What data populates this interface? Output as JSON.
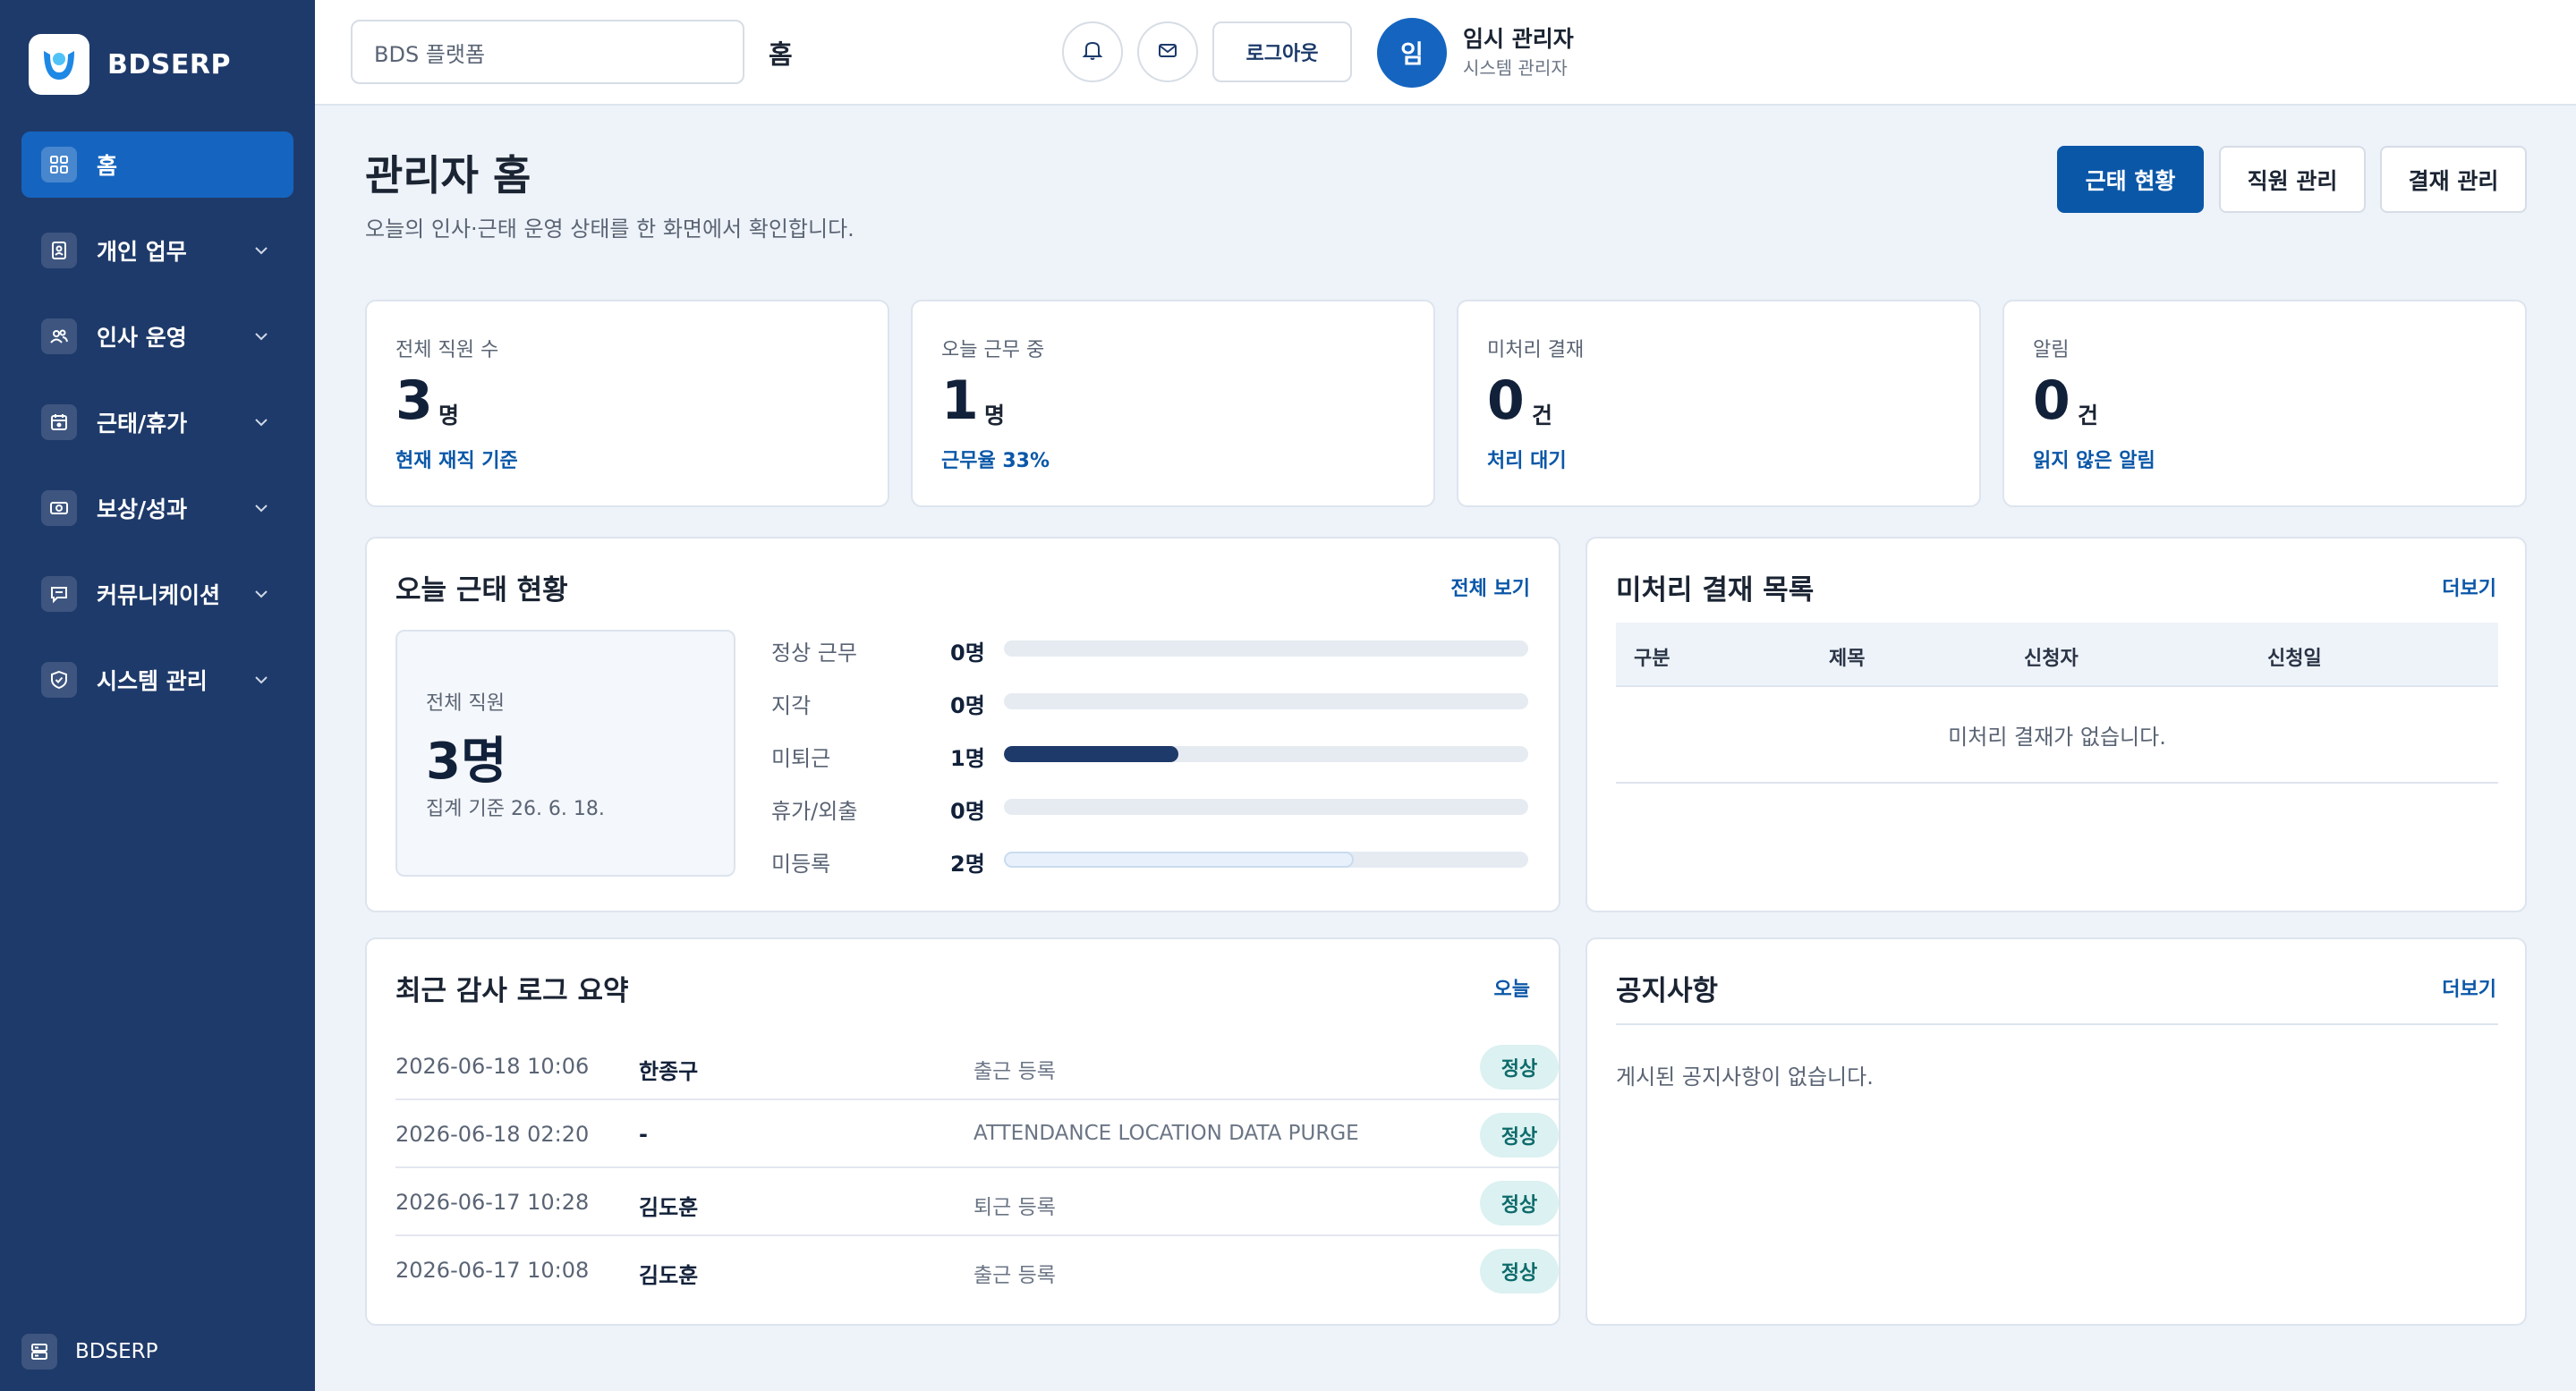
{
  "app": {
    "name": "BDSERP",
    "footer_label": "BDSERP"
  },
  "sidebar": {
    "items": [
      {
        "label": "홈",
        "icon": "grid-icon",
        "active": true
      },
      {
        "label": "개인 업무",
        "icon": "id-card-icon"
      },
      {
        "label": "인사 운영",
        "icon": "users-icon"
      },
      {
        "label": "근태/휴가",
        "icon": "calendar-icon"
      },
      {
        "label": "보상/성과",
        "icon": "money-icon"
      },
      {
        "label": "커뮤니케이션",
        "icon": "chat-icon"
      },
      {
        "label": "시스템 관리",
        "icon": "shield-icon"
      }
    ]
  },
  "header": {
    "platform": "BDS 플랫폼",
    "breadcrumb": "홈",
    "logout_label": "로그아웃",
    "user": {
      "initial": "임",
      "name": "임시 관리자",
      "role": "시스템 관리자"
    }
  },
  "page": {
    "title": "관리자 홈",
    "subtitle": "오늘의 인사·근태 운영 상태를 한 화면에서 확인합니다.",
    "actions": [
      "근태 현황",
      "직원 관리",
      "결재 관리"
    ]
  },
  "stats": [
    {
      "label": "전체 직원 수",
      "value": "3",
      "unit": "명",
      "foot": "현재 재직 기준"
    },
    {
      "label": "오늘 근무 중",
      "value": "1",
      "unit": "명",
      "foot": "근무율 33%"
    },
    {
      "label": "미처리 결재",
      "value": "0",
      "unit": "건",
      "foot": "처리 대기"
    },
    {
      "label": "알림",
      "value": "0",
      "unit": "건",
      "foot": "읽지 않은 알림"
    }
  ],
  "attendance": {
    "title": "오늘 근태 현황",
    "link": "전체 보기",
    "summary": {
      "label": "전체 직원",
      "value": "3명",
      "foot": "집계 기준 26. 6. 18."
    },
    "rows": [
      {
        "name": "정상 근무",
        "count": "0명",
        "fraction": 0,
        "style": "dark"
      },
      {
        "name": "지각",
        "count": "0명",
        "fraction": 0,
        "style": "dark"
      },
      {
        "name": "미퇴근",
        "count": "1명",
        "fraction": 0.333,
        "style": "dark"
      },
      {
        "name": "휴가/외출",
        "count": "0명",
        "fraction": 0,
        "style": "dark"
      },
      {
        "name": "미등록",
        "count": "2명",
        "fraction": 0.667,
        "style": "light"
      }
    ]
  },
  "approvals": {
    "title": "미처리 결재 목록",
    "link": "더보기",
    "columns": [
      "구분",
      "제목",
      "신청자",
      "신청일"
    ],
    "empty": "미처리 결재가 없습니다."
  },
  "audit": {
    "title": "최근 감사 로그 요약",
    "link": "오늘",
    "rows": [
      {
        "time": "2026-06-18 10:06",
        "user": "한종구",
        "action": "출근 등록",
        "status": "정상"
      },
      {
        "time": "2026-06-18 02:20",
        "user": "-",
        "action": "ATTENDANCE LOCATION DATA PURGE",
        "status": "정상"
      },
      {
        "time": "2026-06-17 10:28",
        "user": "김도훈",
        "action": "퇴근 등록",
        "status": "정상"
      },
      {
        "time": "2026-06-17 10:08",
        "user": "김도훈",
        "action": "출근 등록",
        "status": "정상"
      }
    ]
  },
  "notices": {
    "title": "공지사항",
    "link": "더보기",
    "empty": "게시된 공지사항이 없습니다."
  },
  "colors": {
    "sidebar": "#1e3a6a",
    "accent": "#1565c0",
    "primary_button": "#0a57a8",
    "bar_dark": "#1e3a6a",
    "bar_light": "#e8f1fb",
    "badge_bg": "#dcf1f1"
  }
}
